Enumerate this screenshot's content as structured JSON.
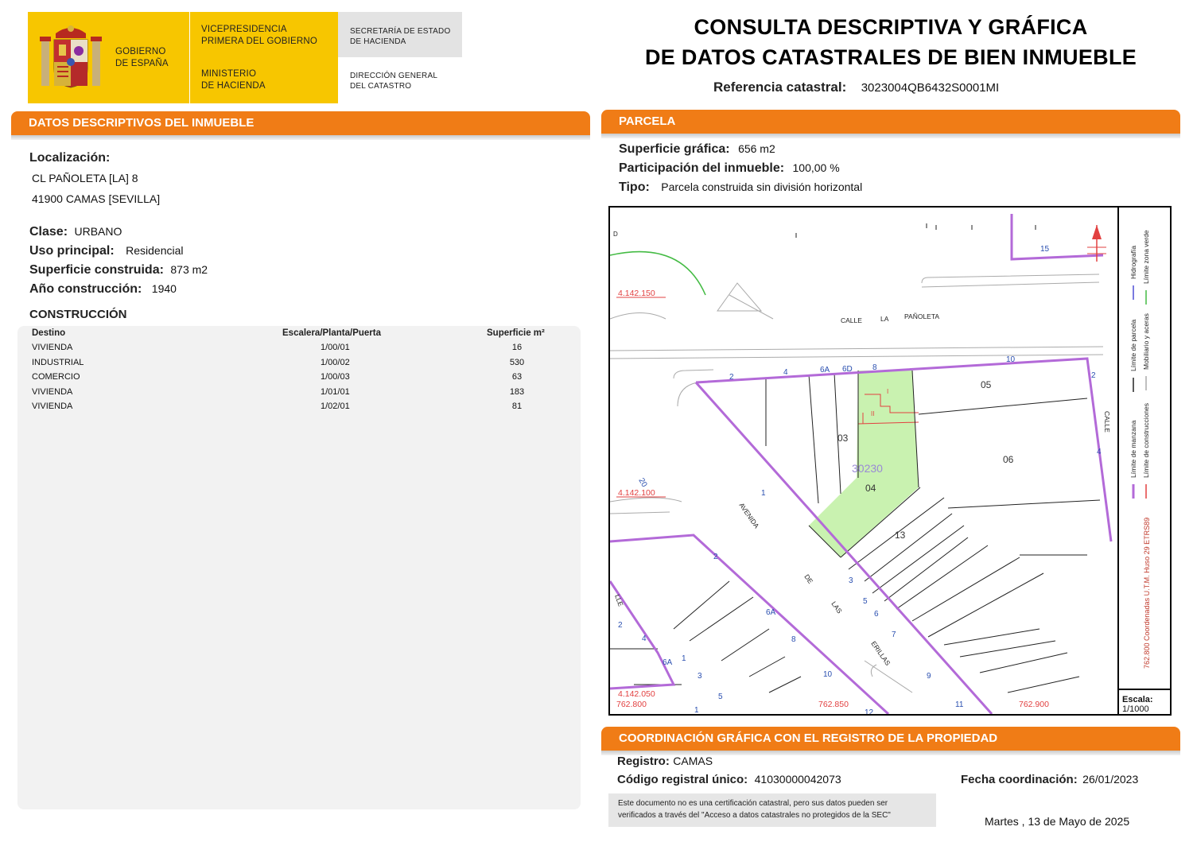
{
  "header": {
    "gov_line1": "GOBIERNO",
    "gov_line2": "DE ESPAÑA",
    "vp_line1": "VICEPRESIDENCIA",
    "vp_line2": "PRIMERA DEL GOBIERNO",
    "min_line1": "MINISTERIO",
    "min_line2": "DE HACIENDA",
    "sec_line1": "SECRETARÍA DE ESTADO",
    "sec_line2": "DE HACIENDA",
    "dg_line1": "DIRECCIÓN GENERAL",
    "dg_line2": "DEL CATASTRO",
    "title_line1": "CONSULTA DESCRIPTIVA Y GRÁFICA",
    "title_line2": "DE DATOS CATASTRALES DE BIEN INMUEBLE",
    "ref_label": "Referencia catastral:",
    "ref_value": "3023004QB6432S0001MI"
  },
  "descriptivos": {
    "section_title": "DATOS DESCRIPTIVOS DEL INMUEBLE",
    "localizacion_label": "Localización:",
    "address_line1": "CL PAÑOLETA [LA] 8",
    "address_line2": "41900 CAMAS [SEVILLA]",
    "clase_label": "Clase:",
    "clase_value": "URBANO",
    "uso_label": "Uso principal:",
    "uso_value": "Residencial",
    "sup_label": "Superficie construida:",
    "sup_value": "873 m2",
    "anio_label": "Año construcción:",
    "anio_value": "1940"
  },
  "construccion": {
    "title": "CONSTRUCCIÓN",
    "headers": [
      "Destino",
      "Escalera/Planta/Puerta",
      "Superficie m²"
    ],
    "rows": [
      [
        "VIVIENDA",
        "1/00/01",
        "16"
      ],
      [
        "INDUSTRIAL",
        "1/00/02",
        "530"
      ],
      [
        "COMERCIO",
        "1/00/03",
        "63"
      ],
      [
        "VIVIENDA",
        "1/01/01",
        "183"
      ],
      [
        "VIVIENDA",
        "1/02/01",
        "81"
      ]
    ]
  },
  "parcela": {
    "section_title": "PARCELA",
    "sup_label": "Superficie gráfica:",
    "sup_value": "656 m2",
    "part_label": "Participación del inmueble:",
    "part_value": "100,00 %",
    "tipo_label": "Tipo:",
    "tipo_value": "Parcela construida sin división horizontal"
  },
  "map": {
    "coord_y1": "4.142.150",
    "coord_y2": "4.142.100",
    "coord_y3": "4.142.050",
    "coord_x1": "762.800",
    "coord_x2": "762.850",
    "coord_x3": "762.900",
    "parcel_id": "30230",
    "labels": [
      "05",
      "06",
      "03",
      "04",
      "13",
      "15",
      "20",
      "2",
      "4",
      "6A",
      "6D",
      "8",
      "10",
      "1",
      "3",
      "5",
      "6",
      "7",
      "9",
      "11",
      "12",
      "13",
      "II",
      "I",
      "D"
    ],
    "street1": [
      "CALLE",
      "LA",
      "PAÑOLETA"
    ],
    "street2": [
      "AVENIDA",
      "DE",
      "LAS",
      "ERILLAS"
    ],
    "street3": "LLE",
    "street4": "CALLE",
    "legend_manzana": "Límite de manzana",
    "legend_parcela": "Límite de parcela",
    "legend_hidro": "Hidrografía",
    "legend_construcciones": "Límite de construcciones",
    "legend_mobiliario": "Mobiliario y aceras",
    "legend_verde": "Límite zona verde",
    "coord_system": "762.800 Coordenadas U.T.M. Huso 29 ETRS89",
    "scale_label": "Escala:",
    "scale_value": "1/1000",
    "color_manzana": "#b36ad8",
    "color_parcel_fill": "#c9f2b0",
    "color_construcciones": "#e24040",
    "color_verde": "#44bb44"
  },
  "coordinacion": {
    "section_title": "COORDINACIÓN GRÁFICA CON EL REGISTRO DE LA PROPIEDAD",
    "registro_label": "Registro:",
    "registro_value": "CAMAS",
    "codigo_label": "Código registral único:",
    "codigo_value": "41030000042073",
    "fecha_label": "Fecha coordinación:",
    "fecha_value": "26/01/2023",
    "note_line1": "Este documento no es una certificación catastral, pero sus datos pueden ser",
    "note_line2": "verificados a través del \"Acceso a datos catastrales no protegidos de la SEC\""
  },
  "footer": {
    "date": "Martes , 13 de Mayo de 2025"
  },
  "colors": {
    "orange": "#f07c16",
    "logo_yellow": "#f7c600"
  }
}
